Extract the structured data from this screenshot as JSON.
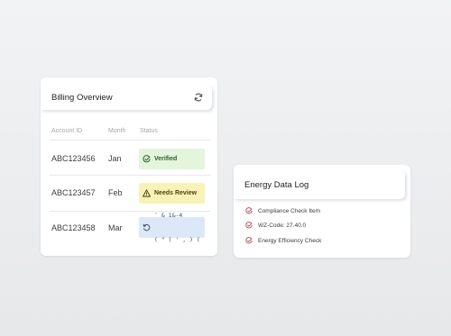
{
  "billing": {
    "title": "Billing Overview",
    "columns": [
      "Account ID",
      "Month",
      "Status"
    ],
    "rows": [
      {
        "account": "ABC123456",
        "month": "Jan",
        "status": "Verified"
      },
      {
        "account": "ABC123457",
        "month": "Feb",
        "status": "Needs Review"
      },
      {
        "account": "ABC123458",
        "month": "Mar",
        "status_line1": "¨ & 1&-4",
        "status_line2": "( \" ) ' , ) ("
      }
    ]
  },
  "energy": {
    "title": "Energy Data Log",
    "items": [
      "Compliance Check Item",
      "WZ-Code: 27.40.0",
      "Energy Efficiency Check"
    ]
  },
  "colors": {
    "verified_bg": "#e3f5dd",
    "review_bg": "#f8f2b6",
    "pending_bg": "#dce8f8",
    "check_accent": "#b4485a"
  },
  "icons": {
    "header": "refresh-icon",
    "verified": "check-circle-icon",
    "review": "warning-icon",
    "pending": "rotate-icon",
    "log": "check-circle-icon"
  }
}
